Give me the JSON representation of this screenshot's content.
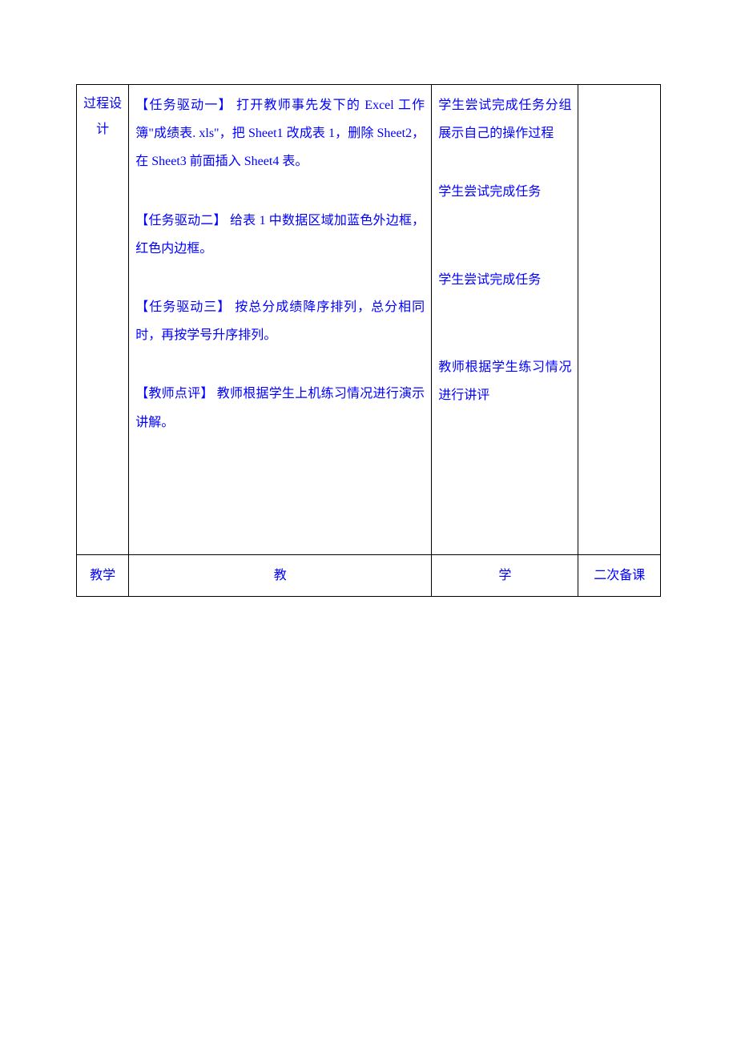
{
  "row1": {
    "label": "过程设计",
    "col2": {
      "task1": "【任务驱动一】  打开教师事先发下的 Excel 工作簿\"成绩表. xls\"，把 Sheet1 改成表 1，删除 Sheet2，在 Sheet3 前面插入 Sheet4 表。",
      "task2": "【任务驱动二】  给表 1 中数据区域加蓝色外边框，红色内边框。",
      "task3": "【任务驱动三】  按总分成绩降序排列，总分相同时，再按学号升序排列。",
      "task4": "【教师点评】  教师根据学生上机练习情况进行演示讲解。"
    },
    "col3": {
      "note1": "学生尝试完成任务分组展示自己的操作过程",
      "note2": "学生尝试完成任务",
      "note3": "学生尝试完成任务",
      "note4": "教师根据学生练习情况进行讲评"
    },
    "col4": ""
  },
  "row2": {
    "label": "教学",
    "col2": "教",
    "col3": "学",
    "col4": "二次备课"
  }
}
